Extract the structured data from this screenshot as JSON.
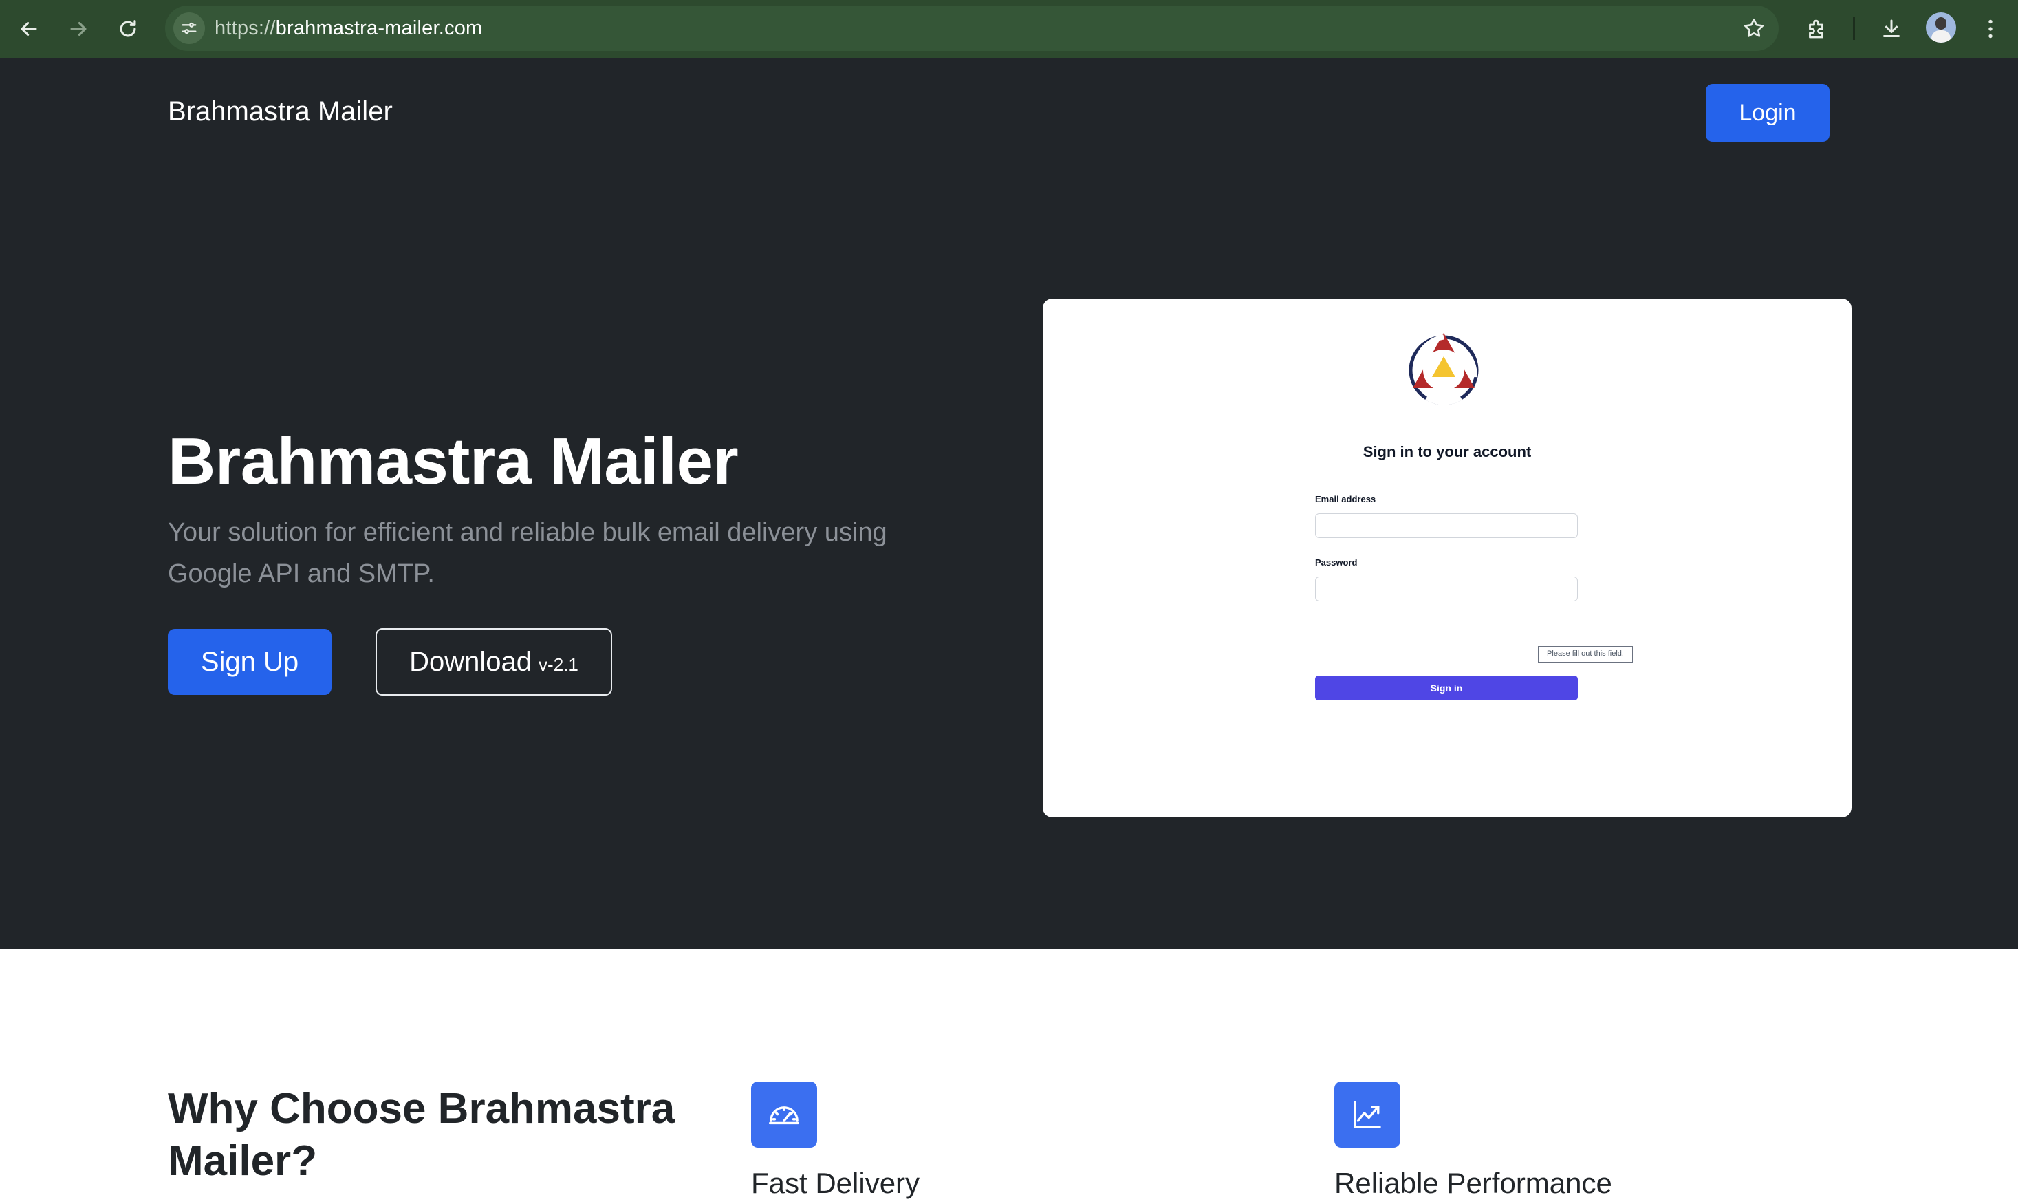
{
  "browser": {
    "url_scheme": "https://",
    "url_host": "brahmastra-mailer.com",
    "icons": {
      "back": "arrow-left-icon",
      "forward": "arrow-right-icon",
      "reload": "reload-icon",
      "site_info": "tune-icon",
      "bookmark": "star-icon",
      "extensions": "puzzle-icon",
      "downloads": "download-icon",
      "menu": "kebab-menu-icon"
    },
    "colors": {
      "toolbar": "#2d4a2e",
      "omnibox": "#355637"
    }
  },
  "header": {
    "brand": "Brahmastra Mailer",
    "login_label": "Login"
  },
  "hero": {
    "title": "Brahmastra Mailer",
    "subtitle": "Your solution for efficient and reliable bulk email delivery using Google API and SMTP.",
    "signup_label": "Sign Up",
    "download_label": "Download",
    "download_version": "v-2.1",
    "colors": {
      "background": "#212529",
      "accent": "#2563eb"
    }
  },
  "preview": {
    "title": "Sign in to your account",
    "email_label": "Email address",
    "password_label": "Password",
    "tooltip": "Please fill out this field.",
    "signin_label": "Sign in",
    "colors": {
      "signin_button": "#4f46e5",
      "logo_red": "#b42a2a",
      "logo_navy": "#1f2a5a",
      "logo_yellow": "#f4c430"
    }
  },
  "features": {
    "heading": "Why Choose Brahmastra Mailer?",
    "items": [
      {
        "title": "Fast Delivery",
        "icon": "speedometer-icon"
      },
      {
        "title": "Reliable Performance",
        "icon": "line-chart-icon"
      }
    ],
    "colors": {
      "icon_bg": "#3b6ff0"
    }
  }
}
